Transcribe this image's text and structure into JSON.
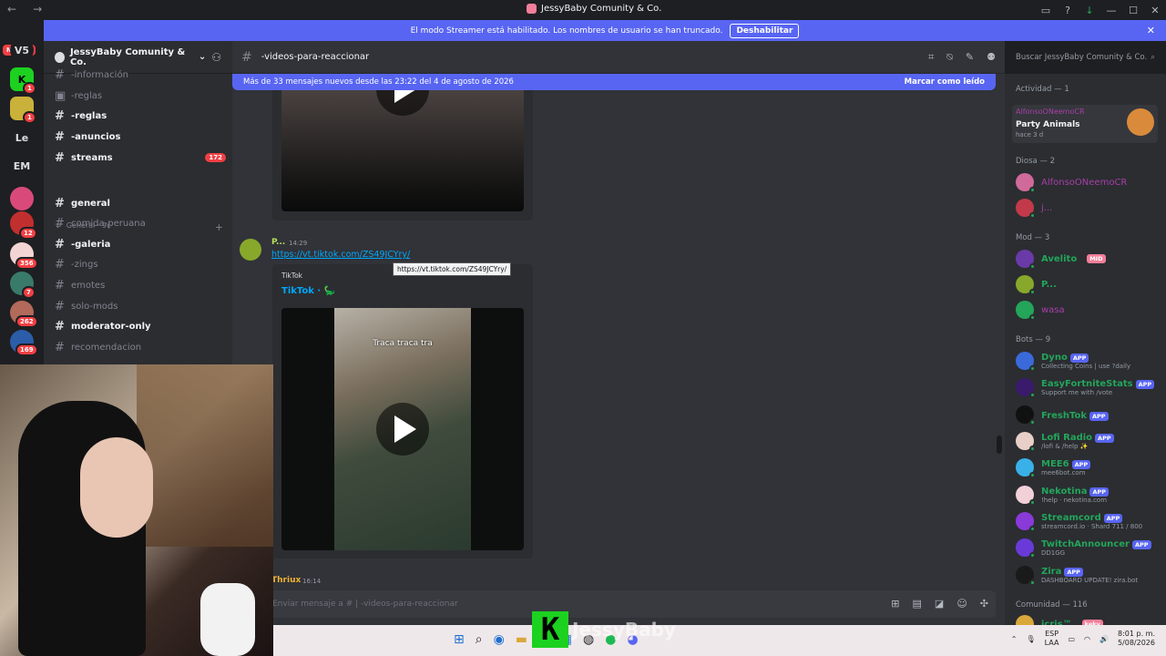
{
  "window": {
    "title": "JessyBaby Comunity & Co."
  },
  "streamer_banner": {
    "text": "El modo Streamer está habilitado. Los nombres de usuario se han truncado.",
    "button": "Deshabilitar"
  },
  "guilds": {
    "new_label": "NUEVO",
    "items": [
      {
        "label": "V5"
      },
      {
        "label": ""
      },
      {
        "label": "Le"
      },
      {
        "label": "EM"
      }
    ],
    "badges": [
      "1",
      "1",
      "12",
      "356",
      "7",
      "262",
      "169"
    ]
  },
  "server": {
    "name": "JessyBaby Comunity & Co."
  },
  "channels": [
    {
      "name": "-información",
      "unread": false
    },
    {
      "name": "-reglas",
      "unread": false
    },
    {
      "name": "-reglas",
      "unread": true
    },
    {
      "name": "-anuncios",
      "unread": true
    },
    {
      "name": "streams",
      "unread": true,
      "badge": "172"
    },
    {
      "name": "general",
      "unread": true
    },
    {
      "name": "comida-peruana",
      "unread": false
    },
    {
      "name": "-galeria",
      "unread": true
    },
    {
      "name": "-zings",
      "unread": false
    },
    {
      "name": "emotes",
      "unread": false
    },
    {
      "name": "solo-mods",
      "unread": false
    },
    {
      "name": "moderator-only",
      "unread": true
    },
    {
      "name": "recomendacion",
      "unread": false
    }
  ],
  "category": {
    "name": "General · 9¢"
  },
  "chat": {
    "channel_name": "-videos-para-reaccionar",
    "search_placeholder": "Buscar JessyBaby Comunity & Co.",
    "new_messages": "Más de 33 mensajes nuevos desde las 23:22 del 4 de agosto de 2026",
    "mark_read": "Marcar como leído",
    "msg_author": "P...",
    "msg_time": "14:29",
    "msg_link": "https://vt.tiktok.com/ZS49JCYry/",
    "tooltip": "https://vt.tiktok.com/ZS49JCYry/",
    "embed_provider": "TikTok",
    "embed_title": "TikTok · 🦕",
    "video_caption": "Traca traca tra",
    "next_author": "Thriux",
    "next_time": "16:14",
    "composer_placeholder": "Enviar mensaje a # | -videos-para-reaccionar"
  },
  "members": {
    "activity_header": "Actividad — 1",
    "activity": {
      "user": "AlfonsoONeemoCR",
      "game": "Party Animals",
      "ago": "hace 3 d"
    },
    "groups": [
      {
        "title": "Diosa — 2",
        "members": [
          {
            "name": "AlfonsoONeemoCR",
            "color": "#a83ea8"
          },
          {
            "name": "j...",
            "color": "#a83ea8"
          }
        ]
      },
      {
        "title": "Mod — 3",
        "members": [
          {
            "name": "Avelito",
            "color": "#23a55a",
            "tag": "MID"
          },
          {
            "name": "P...",
            "color": "#23a55a"
          },
          {
            "name": "wasa",
            "color": "#a83ea8"
          }
        ]
      },
      {
        "title": "Bots — 9",
        "members": [
          {
            "name": "Dyno",
            "sub": "Collecting Coins | use ?daily",
            "app": "APP"
          },
          {
            "name": "EasyFortniteStats",
            "sub": "Support me with /vote",
            "app": "APP"
          },
          {
            "name": "FreshTok",
            "sub": "",
            "app": "APP"
          },
          {
            "name": "Lofi Radio",
            "sub": "/lofi & /help ✨",
            "app": "APP"
          },
          {
            "name": "MEE6",
            "sub": "mee6bot.com",
            "app": "APP"
          },
          {
            "name": "Nekotina",
            "sub": "!help · nekotina.com",
            "app": "APP"
          },
          {
            "name": "Streamcord",
            "sub": "streamcord.io · Shard 711 / 800",
            "app": "APP"
          },
          {
            "name": "TwitchAnnouncer",
            "sub": "DD1GG",
            "app": "APP"
          },
          {
            "name": "Zira",
            "sub": "DASHBOARD UPDATE! zira.bot",
            "app": "APP"
          }
        ]
      },
      {
        "title": "Comunidad — 116",
        "members": [
          {
            "name": "icris™",
            "tag": "keky"
          }
        ]
      }
    ]
  },
  "taskbar": {
    "lang": "ESP",
    "lang2": "LAA",
    "time": "8:01 p. m.",
    "date": "5/08/2026"
  },
  "watermark": {
    "letter": "K",
    "text": "JessyBaby"
  },
  "colors": {
    "blurple": "#5865f2",
    "green": "#23a55a",
    "red": "#f23f43"
  }
}
